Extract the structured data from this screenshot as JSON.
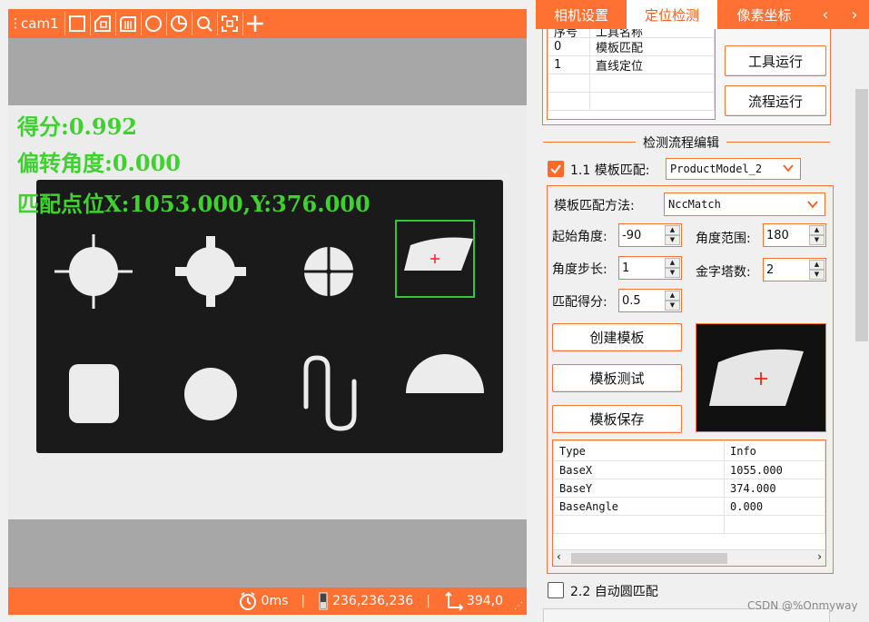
{
  "camera": {
    "name": "cam1",
    "overlay": {
      "score": "得分:0.992",
      "angle": "偏转角度:0.000",
      "position": "匹配点位X:1053.000,Y:376.000"
    },
    "status": {
      "time": "0ms",
      "rgb": "236,236,236",
      "coords": "394,0"
    },
    "toolbar_icons": [
      "rect-icon",
      "polygon-icon",
      "mask-icon",
      "circle-icon",
      "pie-icon",
      "zoom-icon",
      "fit-icon",
      "crosshair-icon"
    ]
  },
  "tabs": [
    "相机设置",
    "定位检测",
    "像素坐标"
  ],
  "active_tab": "定位检测",
  "tool_table": {
    "headers": [
      "序号",
      "工具名称"
    ],
    "rows": [
      {
        "id": "0",
        "name": "模板匹配"
      },
      {
        "id": "1",
        "name": "直线定位"
      }
    ]
  },
  "buttons": {
    "tool_run": "工具运行",
    "flow_run": "流程运行",
    "create_template": "创建模板",
    "test_template": "模板测试",
    "save_template": "模板保存"
  },
  "section_title": "检测流程编辑",
  "step1": {
    "label": "1.1 模板匹配:",
    "checked": true,
    "model": "ProductModel_2"
  },
  "params": {
    "method_label": "模板匹配方法:",
    "method": "NccMatch",
    "start_angle_label": "起始角度:",
    "start_angle": "-90",
    "angle_range_label": "角度范围:",
    "angle_range": "180",
    "angle_step_label": "角度步长:",
    "angle_step": "1",
    "pyramid_label": "金字塔数:",
    "pyramid": "2",
    "score_label": "匹配得分:",
    "score": "0.5"
  },
  "result_table": {
    "headers": [
      "Type",
      "Info"
    ],
    "rows": [
      {
        "type": "BaseX",
        "info": "1055.000"
      },
      {
        "type": "BaseY",
        "info": "374.000"
      },
      {
        "type": "BaseAngle",
        "info": "0.000"
      }
    ]
  },
  "step2": {
    "label": "2.2 自动圆匹配",
    "checked": false
  },
  "watermark": "CSDN @%Onmyway",
  "colors": {
    "accent": "#ff7033",
    "overlay_text": "#3fd12f",
    "match_box": "#35c53a",
    "crosshair": "#ff2020"
  }
}
